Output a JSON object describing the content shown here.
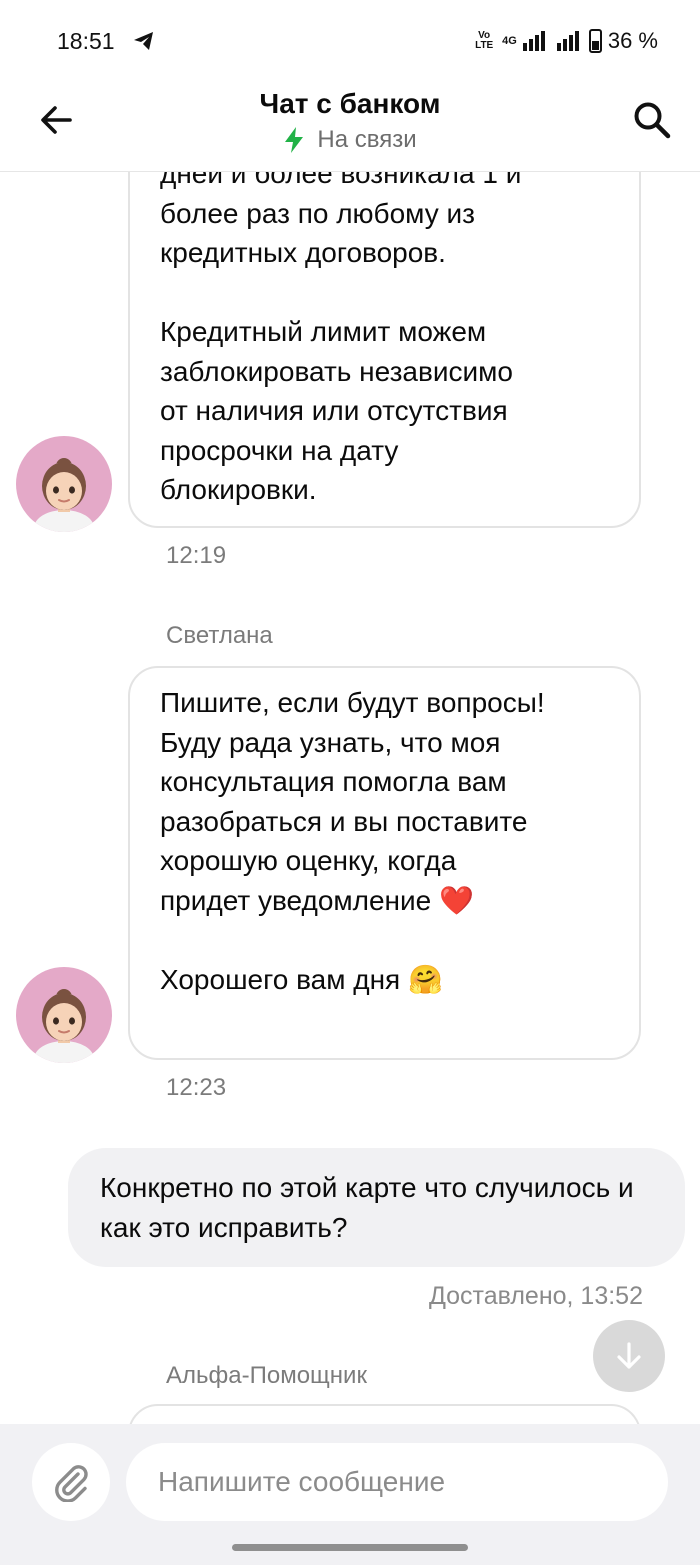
{
  "status_bar": {
    "time": "18:51",
    "network_volte": "Vo LTE",
    "network_type": "4G",
    "battery": "36 %"
  },
  "header": {
    "title": "Чат с банком",
    "status": "На связи",
    "status_color": "#21b247"
  },
  "messages": [
    {
      "text": "дней и более возникала 1 и\nболее раз по любому из\nкредитных договоров.\n\nКредитный лимит можем\nзаблокировать независимо\nот наличия или отсутствия\nпросрочки на дату\nблокировки.",
      "time": "12:19"
    },
    {
      "sender": "Светлана",
      "text": "Пишите, если будут вопросы!\nБуду рада узнать, что моя\nконсультация помогла вам\nразобраться и вы поставите\nхорошую оценку, когда\nпридет уведомление ❤️\n\nХорошего вам дня 🤗",
      "time": "12:23"
    },
    {
      "outgoing": true,
      "text": "Конкретно по этой карте что случилось и как это исправить?",
      "status": "Доставлено, 13:52"
    },
    {
      "sender": "Альфа-Помощник",
      "text": ""
    }
  ],
  "composer": {
    "placeholder": "Напишите сообщение"
  },
  "icons": {
    "back": "arrow-left-icon",
    "search": "search-icon",
    "status": "lightning-icon",
    "attach": "paperclip-icon",
    "scroll": "arrow-down-icon"
  }
}
